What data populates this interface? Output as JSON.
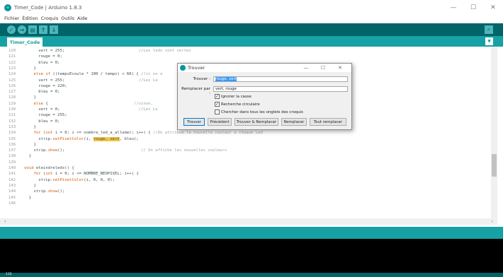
{
  "window": {
    "title": "Timer_Code | Arduino 1.8.3",
    "controls": [
      "—",
      "☐",
      "✕"
    ]
  },
  "menu": [
    "Fichier",
    "Édition",
    "Croquis",
    "Outils",
    "Aide"
  ],
  "toolbar": {
    "buttons": [
      {
        "name": "verify-icon",
        "glyph": "✓"
      },
      {
        "name": "upload-icon",
        "glyph": "→"
      },
      {
        "name": "new-icon",
        "glyph": "▤"
      },
      {
        "name": "open-icon",
        "glyph": "↑"
      },
      {
        "name": "save-icon",
        "glyph": "↓"
      }
    ],
    "serial_monitor_glyph": "⌕"
  },
  "tabs": {
    "active": "Timer_Code",
    "menu_glyph": "▼"
  },
  "editor": {
    "lines": [
      {
        "n": "120",
        "segs": [
          [
            "      vert = 255;                               ",
            ""
          ],
          [
            "//Les leds sont vertes",
            "cm"
          ]
        ]
      },
      {
        "n": "121",
        "segs": [
          [
            "      rouge = 0;",
            ""
          ]
        ]
      },
      {
        "n": "122",
        "segs": [
          [
            "      bleu = 0;",
            ""
          ]
        ]
      },
      {
        "n": "123",
        "segs": [
          [
            "    }",
            ""
          ]
        ]
      },
      {
        "n": "124",
        "segs": [
          [
            "    ",
            ""
          ],
          [
            "else if",
            "kw"
          ],
          [
            " ((tempsEcoule * 100 / temps) < 66) { ",
            ""
          ],
          [
            "//si on e",
            "cm"
          ]
        ]
      },
      {
        "n": "125",
        "segs": [
          [
            "      vert = 255;                               ",
            ""
          ],
          [
            "//Les Le",
            "cm"
          ]
        ]
      },
      {
        "n": "126",
        "segs": [
          [
            "      rouge = 220;",
            ""
          ]
        ]
      },
      {
        "n": "127",
        "segs": [
          [
            "      bleu = 0;",
            ""
          ]
        ]
      },
      {
        "n": "128",
        "segs": [
          [
            "    }",
            ""
          ]
        ]
      },
      {
        "n": "129",
        "segs": [
          [
            "    ",
            ""
          ],
          [
            "else",
            "kw"
          ],
          [
            " {                                    ",
            ""
          ],
          [
            "//sinon,",
            "cm"
          ]
        ]
      },
      {
        "n": "130",
        "segs": [
          [
            "      vert = 0;                                 ",
            ""
          ],
          [
            "//Les Le",
            "cm"
          ]
        ]
      },
      {
        "n": "131",
        "segs": [
          [
            "      rouge = 255;",
            ""
          ]
        ]
      },
      {
        "n": "132",
        "segs": [
          [
            "      bleu = 0;",
            ""
          ]
        ]
      },
      {
        "n": "133",
        "segs": [
          [
            "    }",
            ""
          ]
        ]
      },
      {
        "n": "134",
        "segs": [
          [
            "    ",
            ""
          ],
          [
            "for",
            "kw"
          ],
          [
            " (",
            ""
          ],
          [
            "int",
            "kw"
          ],
          [
            " i = 0; i <= nombre_led_a_allumer; i++) { ",
            ""
          ],
          [
            "//On attribue la nouvelle couleur a chaque Led",
            "cm"
          ]
        ]
      },
      {
        "n": "135",
        "segs": [
          [
            "      strip.",
            ""
          ],
          [
            "setPixelColor",
            "fn"
          ],
          [
            "(i, ",
            ""
          ],
          [
            "rouge, vert",
            "hl"
          ],
          [
            ", bleu);",
            ""
          ]
        ]
      },
      {
        "n": "136",
        "segs": [
          [
            "    }",
            ""
          ]
        ]
      },
      {
        "n": "137",
        "segs": [
          [
            "    strip.",
            ""
          ],
          [
            "show",
            "fn"
          ],
          [
            "();                                ",
            ""
          ],
          [
            "// On affiche les nouvelles couleurs",
            "cm"
          ]
        ]
      },
      {
        "n": "138",
        "segs": [
          [
            "  }",
            ""
          ]
        ]
      },
      {
        "n": "139",
        "segs": [
          [
            "",
            ""
          ]
        ]
      },
      {
        "n": "140",
        "segs": [
          [
            "void",
            "kw"
          ],
          [
            " eteindreleds() {",
            ""
          ]
        ]
      },
      {
        "n": "141",
        "segs": [
          [
            "    ",
            ""
          ],
          [
            "for",
            "kw"
          ],
          [
            " (",
            ""
          ],
          [
            "int",
            "kw"
          ],
          [
            " i = 0; i <= NOMBRE_NEOPIXEL; i++) {",
            ""
          ]
        ]
      },
      {
        "n": "142",
        "segs": [
          [
            "      strip.",
            ""
          ],
          [
            "setPixelColor",
            "fn"
          ],
          [
            "(i, 0, 0, 0);",
            ""
          ]
        ]
      },
      {
        "n": "143",
        "segs": [
          [
            "    }",
            ""
          ]
        ]
      },
      {
        "n": "144",
        "segs": [
          [
            "    strip.",
            ""
          ],
          [
            "show",
            "fn"
          ],
          [
            "();",
            ""
          ]
        ]
      },
      {
        "n": "145",
        "segs": [
          [
            "  }",
            ""
          ]
        ]
      },
      {
        "n": "146",
        "segs": [
          [
            "",
            ""
          ]
        ]
      }
    ]
  },
  "dialog": {
    "title": "Trouver",
    "controls": [
      "—",
      "☐",
      "✕"
    ],
    "find_label": "Trouver :",
    "find_value": "rouge, vert",
    "replace_label": "Remplacer par :",
    "replace_value": "vert, rouge",
    "options": [
      {
        "label": "Ignorer la casse",
        "checked": true
      },
      {
        "label": "Recherche circulaire",
        "checked": true
      },
      {
        "label": "Chercher dans tous les onglets des croquis",
        "checked": false
      }
    ],
    "buttons": [
      "Trouver",
      "Précédent",
      "Trouver & Remplacer",
      "Remplacer",
      "Tout remplacer"
    ]
  },
  "status": {
    "line_number": "135"
  },
  "colors": {
    "toolbar": "#006468",
    "tabbar": "#17a1a5",
    "highlight": "#f3c744"
  }
}
